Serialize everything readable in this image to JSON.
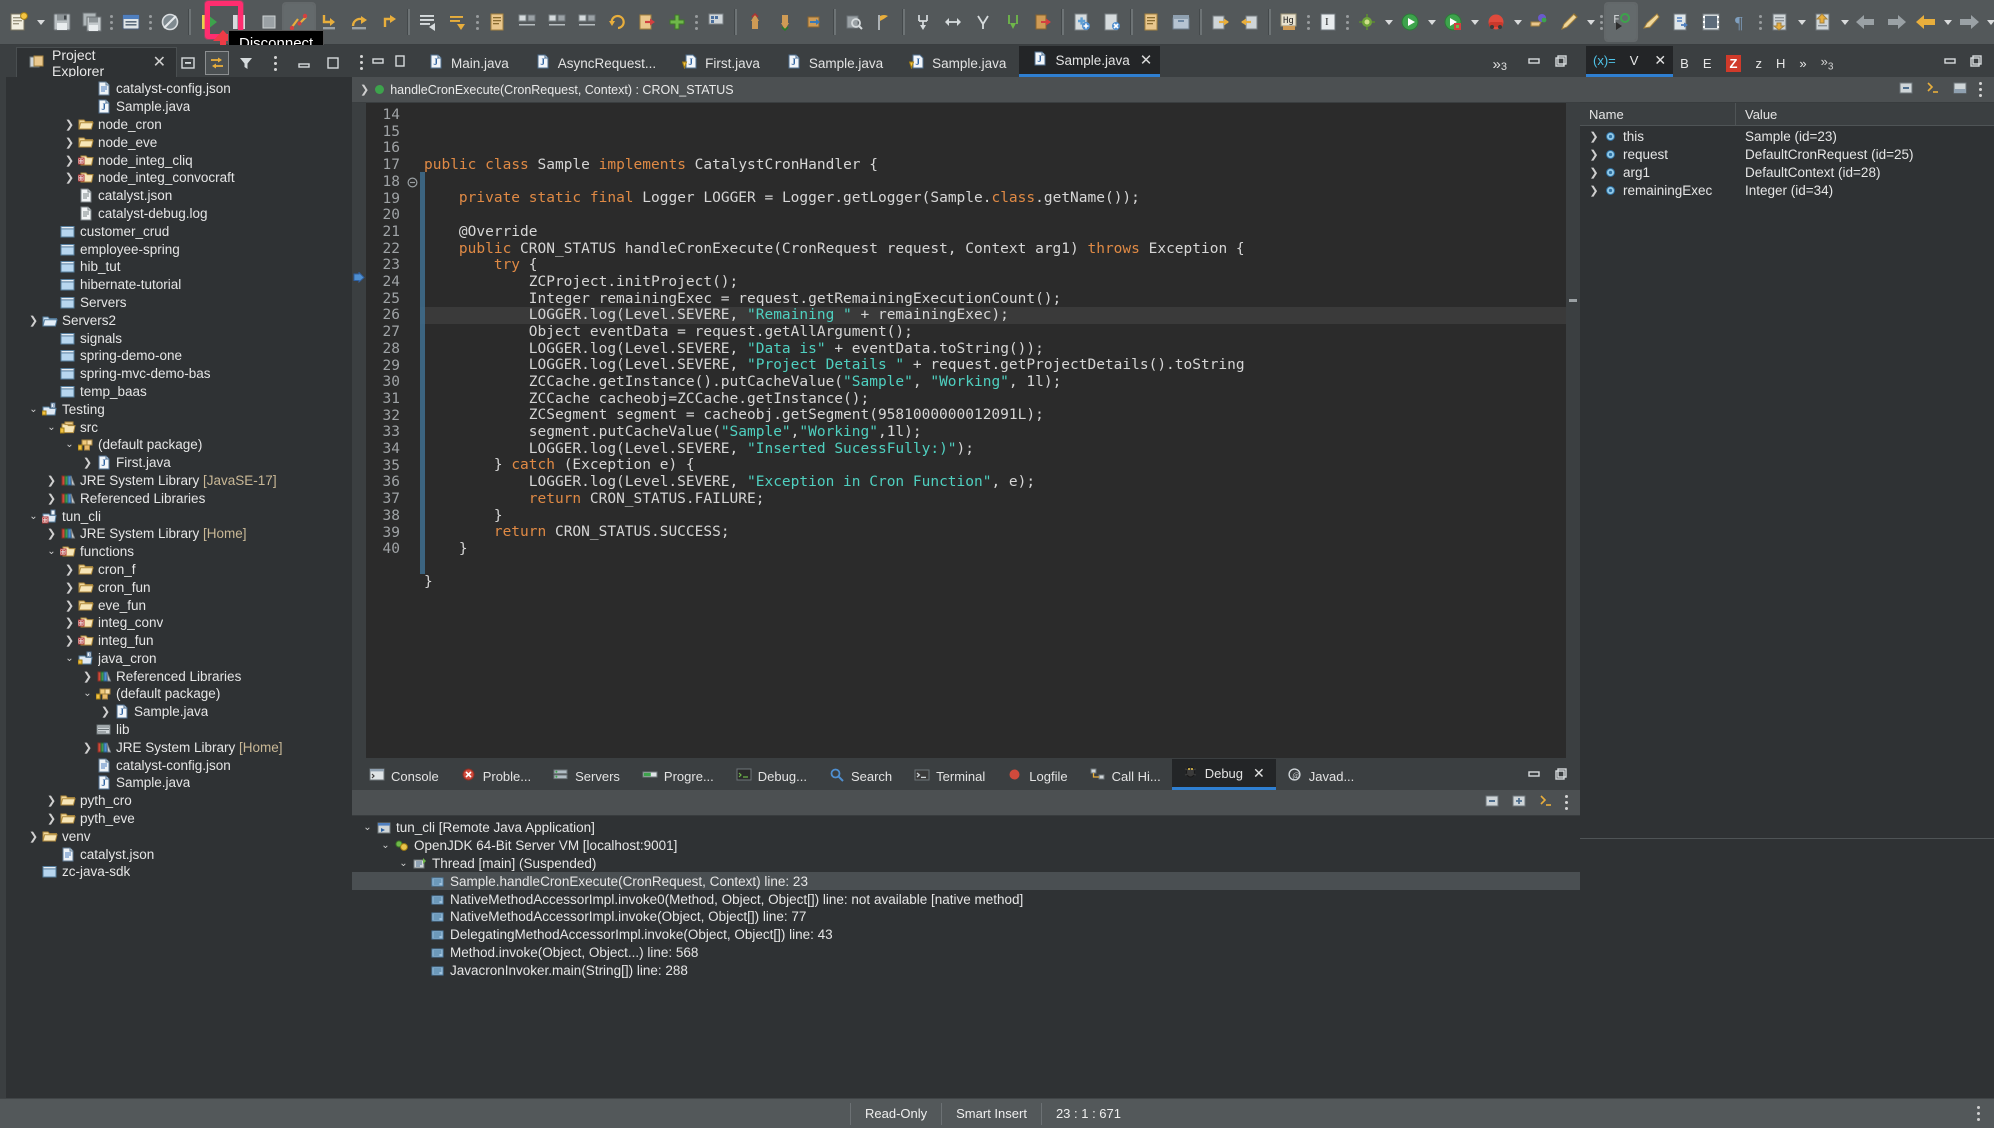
{
  "annotation": {
    "label": "Disconnect",
    "highlight_color": "#ff2d6f"
  },
  "toolbar": {
    "icons": [
      "new-wizard-icon",
      "save-icon",
      "save-all-icon",
      "toggle-mark-occurrences-icon",
      "skip-all-breakpoints-icon",
      "resume-icon",
      "suspend-icon",
      "terminate-icon",
      "disconnect-icon",
      "step-into-icon",
      "step-over-icon",
      "step-return-icon",
      "drop-to-frame-icon",
      "use-step-filters-icon",
      "copy-icon",
      "indent-icon",
      "outdent-icon",
      "shift-icon",
      "undo-icon",
      "redo-icon",
      "add-icon",
      "show-whitespace-icon",
      "open-type-icon",
      "open-task-icon",
      "search-icon",
      "link-icon",
      "next-annotation-icon",
      "previous-annotation-icon",
      "last-edit-icon",
      "back-icon",
      "forward-icon",
      "run-icon",
      "debug-icon",
      "coverage-icon",
      "external-tools-icon",
      "new-java-project-icon",
      "new-class-icon",
      "run-last-icon",
      "profile-icon",
      "terminal-icon",
      "pilcrow-icon",
      "export-icon",
      "import-icon",
      "new-window-icon"
    ]
  },
  "project_explorer": {
    "tab_label": "Project Explorer",
    "close_icon": "close-icon",
    "tools": [
      "collapse-all-icon",
      "link-with-editor-icon",
      "filter-icon",
      "view-menu-icon"
    ],
    "min_icon": "minimize-icon",
    "max_icon": "maximize-icon",
    "tree": [
      {
        "indent": 4,
        "twisty": "",
        "icon": "json-file-icon",
        "label": "catalyst-config.json"
      },
      {
        "indent": 4,
        "twisty": "",
        "icon": "java-file-icon",
        "label": "Sample.java"
      },
      {
        "indent": 3,
        "twisty": ">",
        "icon": "folder-icon",
        "label": "node_cron"
      },
      {
        "indent": 3,
        "twisty": ">",
        "icon": "folder-icon",
        "label": "node_eve"
      },
      {
        "indent": 3,
        "twisty": ">",
        "icon": "folder-red-icon",
        "label": "node_integ_cliq"
      },
      {
        "indent": 3,
        "twisty": ">",
        "icon": "folder-red-icon",
        "label": "node_integ_convocraft"
      },
      {
        "indent": 3,
        "twisty": "",
        "icon": "file-icon",
        "label": "catalyst.json"
      },
      {
        "indent": 3,
        "twisty": "",
        "icon": "file-icon",
        "label": "catalyst-debug.log"
      },
      {
        "indent": 2,
        "twisty": "",
        "icon": "project-closed-icon",
        "label": "customer_crud"
      },
      {
        "indent": 2,
        "twisty": "",
        "icon": "project-closed-icon",
        "label": "employee-spring"
      },
      {
        "indent": 2,
        "twisty": "",
        "icon": "project-closed-icon",
        "label": "hib_tut"
      },
      {
        "indent": 2,
        "twisty": "",
        "icon": "project-closed-icon",
        "label": "hibernate-tutorial"
      },
      {
        "indent": 2,
        "twisty": "",
        "icon": "project-closed-icon",
        "label": "Servers"
      },
      {
        "indent": 1,
        "twisty": ">",
        "icon": "project-open-icon",
        "label": "Servers2"
      },
      {
        "indent": 2,
        "twisty": "",
        "icon": "project-closed-icon",
        "label": "signals"
      },
      {
        "indent": 2,
        "twisty": "",
        "icon": "project-closed-icon",
        "label": "spring-demo-one"
      },
      {
        "indent": 2,
        "twisty": "",
        "icon": "project-closed-icon",
        "label": "spring-mvc-demo-bas"
      },
      {
        "indent": 2,
        "twisty": "",
        "icon": "project-closed-icon",
        "label": "temp_baas"
      },
      {
        "indent": 1,
        "twisty": "v",
        "icon": "java-project-icon",
        "label": "Testing"
      },
      {
        "indent": 2,
        "twisty": "v",
        "icon": "source-folder-icon",
        "label": "src"
      },
      {
        "indent": 3,
        "twisty": "v",
        "icon": "package-icon",
        "label": "(default package)"
      },
      {
        "indent": 4,
        "twisty": ">",
        "icon": "java-file-icon",
        "label": "First.java"
      },
      {
        "indent": 2,
        "twisty": ">",
        "icon": "library-icon",
        "label": "JRE System Library",
        "suffix": "[JavaSE-17]"
      },
      {
        "indent": 2,
        "twisty": ">",
        "icon": "library-icon",
        "label": "Referenced Libraries"
      },
      {
        "indent": 1,
        "twisty": "v",
        "icon": "java-project-red-icon",
        "label": "tun_cli"
      },
      {
        "indent": 2,
        "twisty": ">",
        "icon": "library-icon",
        "label": "JRE System Library",
        "suffix": "[Home]"
      },
      {
        "indent": 2,
        "twisty": "v",
        "icon": "folder-red-icon",
        "label": "functions"
      },
      {
        "indent": 3,
        "twisty": ">",
        "icon": "folder-icon",
        "label": "cron_f"
      },
      {
        "indent": 3,
        "twisty": ">",
        "icon": "folder-icon",
        "label": "cron_fun"
      },
      {
        "indent": 3,
        "twisty": ">",
        "icon": "folder-icon",
        "label": "eve_fun"
      },
      {
        "indent": 3,
        "twisty": ">",
        "icon": "folder-red-icon",
        "label": "integ_conv"
      },
      {
        "indent": 3,
        "twisty": ">",
        "icon": "folder-red-icon",
        "label": "integ_fun"
      },
      {
        "indent": 3,
        "twisty": "v",
        "icon": "java-project-icon",
        "label": "java_cron"
      },
      {
        "indent": 4,
        "twisty": ">",
        "icon": "library-icon",
        "label": "Referenced Libraries"
      },
      {
        "indent": 4,
        "twisty": "v",
        "icon": "package-icon",
        "label": "(default package)"
      },
      {
        "indent": 5,
        "twisty": ">",
        "icon": "java-file-icon",
        "label": "Sample.java"
      },
      {
        "indent": 4,
        "twisty": "",
        "icon": "lib-folder-icon",
        "label": "lib"
      },
      {
        "indent": 4,
        "twisty": ">",
        "icon": "library-icon",
        "label": "JRE System Library",
        "suffix": "[Home]"
      },
      {
        "indent": 4,
        "twisty": "",
        "icon": "json-file-icon",
        "label": "catalyst-config.json"
      },
      {
        "indent": 4,
        "twisty": "",
        "icon": "java-file-icon",
        "label": "Sample.java"
      },
      {
        "indent": 2,
        "twisty": ">",
        "icon": "folder-icon",
        "label": "pyth_cro"
      },
      {
        "indent": 2,
        "twisty": ">",
        "icon": "folder-icon",
        "label": "pyth_eve"
      },
      {
        "indent": 1,
        "twisty": ">",
        "icon": "folder-icon",
        "label": "venv"
      },
      {
        "indent": 2,
        "twisty": "",
        "icon": "json-file-icon",
        "label": "catalyst.json"
      },
      {
        "indent": 1,
        "twisty": "",
        "icon": "project-closed-icon",
        "label": "zc-java-sdk"
      }
    ]
  },
  "editor": {
    "left_tools": [
      "view-menu-icon",
      "minimize-icon",
      "maximize-icon"
    ],
    "tabs": [
      {
        "label": "Main.java",
        "icon": "java-file-icon",
        "active": false,
        "closable": false
      },
      {
        "label": "AsyncRequest...",
        "icon": "java-file-icon",
        "active": false,
        "closable": false
      },
      {
        "label": "First.java",
        "icon": "java-file-warn-icon",
        "active": false,
        "closable": false
      },
      {
        "label": "Sample.java",
        "icon": "java-file-icon",
        "active": false,
        "closable": false
      },
      {
        "label": "Sample.java",
        "icon": "java-file-warn-icon",
        "active": false,
        "closable": false
      },
      {
        "label": "Sample.java",
        "icon": "java-file-icon",
        "active": true,
        "closable": true
      }
    ],
    "overflow_label": "»",
    "overflow_count": "3",
    "window_buttons": [
      "minimize-icon",
      "maximize-icon"
    ],
    "breadcrumb": "handleCronExecute(CronRequest, Context) : CRON_STATUS",
    "first_line_number": 14,
    "current_line": 23,
    "code": [
      {
        "n": 14,
        "fold": "",
        "html": "<span class=\"kw\">public</span> <span class=\"kw\">class</span> Sample <span class=\"kw\">implements</span> CatalystCronHandler {"
      },
      {
        "n": 15,
        "fold": "",
        "html": ""
      },
      {
        "n": 16,
        "fold": "",
        "html": "    <span class=\"kw\">private</span> <span class=\"kw\">static</span> <span class=\"kw\">final</span> Logger LOGGER = Logger.getLogger(Sample.<span class=\"kw\">class</span>.getName());"
      },
      {
        "n": 17,
        "fold": "",
        "html": ""
      },
      {
        "n": 18,
        "fold": "o",
        "html": "    @Override"
      },
      {
        "n": 19,
        "fold": "",
        "html": "    <span class=\"kw\">public</span> CRON_STATUS handleCronExecute(CronRequest request, Context arg1) <span class=\"kw\">throws</span> Exception {"
      },
      {
        "n": 20,
        "fold": "",
        "html": "        <span class=\"kw\">try</span> {"
      },
      {
        "n": 21,
        "fold": "",
        "html": "            ZCProject.initProject();"
      },
      {
        "n": 22,
        "fold": "",
        "html": "            Integer remainingExec = request.getRemainingExecutionCount();"
      },
      {
        "n": 23,
        "fold": "",
        "html": "            LOGGER.log(Level.SEVERE, <span class=\"str\">\"Remaining \"</span> + remainingExec);"
      },
      {
        "n": 24,
        "fold": "",
        "html": "            Object eventData = request.getAllArgument();"
      },
      {
        "n": 25,
        "fold": "",
        "html": "            LOGGER.log(Level.SEVERE, <span class=\"str\">\"Data is\"</span> + eventData.toString());"
      },
      {
        "n": 26,
        "fold": "",
        "html": "            LOGGER.log(Level.SEVERE, <span class=\"str\">\"Project Details \"</span> + request.getProjectDetails().toString"
      },
      {
        "n": 27,
        "fold": "",
        "html": "            ZCCache.getInstance().putCacheValue(<span class=\"str\">\"Sample\"</span>, <span class=\"str\">\"Working\"</span>, 1l);"
      },
      {
        "n": 28,
        "fold": "",
        "html": "            ZCCache cacheobj=ZCCache.getInstance();"
      },
      {
        "n": 29,
        "fold": "",
        "html": "            ZCSegment segment = cacheobj.getSegment(9581000000012091L);"
      },
      {
        "n": 30,
        "fold": "",
        "html": "            segment.putCacheValue(<span class=\"str\">\"Sample\"</span>,<span class=\"str\">\"Working\"</span>,1l);"
      },
      {
        "n": 31,
        "fold": "",
        "html": "            LOGGER.log(Level.SEVERE, <span class=\"str\">\"Inserted SucessFully:)\"</span>);"
      },
      {
        "n": 32,
        "fold": "",
        "html": "        } <span class=\"kw\">catch</span> (Exception e) {"
      },
      {
        "n": 33,
        "fold": "",
        "html": "            LOGGER.log(Level.SEVERE, <span class=\"str\">\"Exception in Cron Function\"</span>, e);"
      },
      {
        "n": 34,
        "fold": "",
        "html": "            <span class=\"kw\">return</span> CRON_STATUS.FAILURE;"
      },
      {
        "n": 35,
        "fold": "",
        "html": "        }"
      },
      {
        "n": 36,
        "fold": "",
        "html": "        <span class=\"kw\">return</span> CRON_STATUS.SUCCESS;"
      },
      {
        "n": 37,
        "fold": "",
        "html": "    }"
      },
      {
        "n": 38,
        "fold": "",
        "html": ""
      },
      {
        "n": 39,
        "fold": "",
        "html": "}"
      },
      {
        "n": 40,
        "fold": "",
        "html": ""
      }
    ]
  },
  "bottom_panel": {
    "tabs": [
      {
        "label": "Console",
        "icon": "console-icon",
        "active": false
      },
      {
        "label": "Proble...",
        "icon": "problems-icon",
        "active": false
      },
      {
        "label": "Servers",
        "icon": "servers-icon",
        "active": false
      },
      {
        "label": "Progre...",
        "icon": "progress-icon",
        "active": false
      },
      {
        "label": "Debug...",
        "icon": "debug-shell-icon",
        "active": false
      },
      {
        "label": "Search",
        "icon": "search-icon",
        "active": false
      },
      {
        "label": "Terminal",
        "icon": "terminal-icon",
        "active": false
      },
      {
        "label": "Logfile",
        "icon": "logfile-icon",
        "active": false
      },
      {
        "label": "Call Hi...",
        "icon": "call-hierarchy-icon",
        "active": false
      },
      {
        "label": "Debug",
        "icon": "debug-icon",
        "active": true,
        "closable": true
      },
      {
        "label": "Javad...",
        "icon": "javadoc-icon",
        "active": false
      }
    ],
    "window_buttons": [
      "minimize-icon",
      "maximize-icon"
    ],
    "toolbar_icons": [
      "collapse-all-icon",
      "expand-all-icon",
      "view-menu-icon"
    ],
    "tree": [
      {
        "indent": 0,
        "twisty": "v",
        "icon": "launch-icon",
        "label": "tun_cli [Remote Java Application]",
        "selected": false
      },
      {
        "indent": 1,
        "twisty": "v",
        "icon": "jvm-icon",
        "label": "OpenJDK 64-Bit Server VM [localhost:9001]",
        "selected": false
      },
      {
        "indent": 2,
        "twisty": "v",
        "icon": "thread-icon",
        "label": "Thread [main] (Suspended)",
        "selected": false
      },
      {
        "indent": 3,
        "twisty": "",
        "icon": "stackframe-icon",
        "label": "Sample.handleCronExecute(CronRequest, Context) line: 23",
        "selected": true
      },
      {
        "indent": 3,
        "twisty": "",
        "icon": "stackframe-icon",
        "label": "NativeMethodAccessorImpl.invoke0(Method, Object, Object[]) line: not available [native method]",
        "selected": false
      },
      {
        "indent": 3,
        "twisty": "",
        "icon": "stackframe-icon",
        "label": "NativeMethodAccessorImpl.invoke(Object, Object[]) line: 77",
        "selected": false
      },
      {
        "indent": 3,
        "twisty": "",
        "icon": "stackframe-icon",
        "label": "DelegatingMethodAccessorImpl.invoke(Object, Object[]) line: 43",
        "selected": false
      },
      {
        "indent": 3,
        "twisty": "",
        "icon": "stackframe-icon",
        "label": "Method.invoke(Object, Object...) line: 568",
        "selected": false
      },
      {
        "indent": 3,
        "twisty": "",
        "icon": "stackframe-icon",
        "label": "JavacronInvoker.main(String[]) line: 288",
        "selected": false
      }
    ]
  },
  "variables_panel": {
    "tabs": [
      {
        "label": "(x)=",
        "icon": "variables-icon",
        "active": true,
        "closable": true,
        "text": "(x)="
      },
      {
        "label": "V",
        "icon": "variables-letter",
        "active": true,
        "text": "V"
      }
    ],
    "tab_icons": [
      {
        "name": "variables-icon",
        "text": "(x)=",
        "color": "#4fc3e8"
      },
      {
        "name": "variables-label",
        "text": "V",
        "color": "#e8e8e8"
      },
      {
        "name": "breakpoints-icon",
        "text": "B",
        "color": "#e8e8e8"
      },
      {
        "name": "expressions-icon",
        "text": "E",
        "color": "#e8e8e8"
      },
      {
        "name": "z-tab-icon",
        "text": "Z",
        "color": "#ffffff"
      },
      {
        "name": "z-tab-label",
        "text": "z",
        "color": "#e8e8e8"
      },
      {
        "name": "hierarchy-icon",
        "text": "H",
        "color": "#e8e8e8"
      },
      {
        "name": "overflow-icon",
        "text": "»",
        "color": "#e8e8e8"
      }
    ],
    "overflow_count": "3",
    "window_buttons": [
      "minimize-icon",
      "maximize-icon"
    ],
    "toolbar_icons": [
      "collapse-all-icon",
      "show-logical-structure-icon",
      "detail-pane-icon",
      "view-menu-icon"
    ],
    "columns": [
      "Name",
      "Value"
    ],
    "rows": [
      {
        "twisty": ">",
        "icon": "object-icon",
        "name": "this",
        "value": "Sample  (id=23)"
      },
      {
        "twisty": ">",
        "icon": "object-icon",
        "name": "request",
        "value": "DefaultCronRequest  (id=25)"
      },
      {
        "twisty": ">",
        "icon": "object-icon",
        "name": "arg1",
        "value": "DefaultContext  (id=28)"
      },
      {
        "twisty": ">",
        "icon": "object-icon",
        "name": "remainingExec",
        "value": "Integer  (id=34)"
      }
    ]
  },
  "status_bar": {
    "read_only": "Read-Only",
    "insert_mode": "Smart Insert",
    "cursor_position": "23 : 1 : 671",
    "menu_icon": "status-menu-icon"
  }
}
